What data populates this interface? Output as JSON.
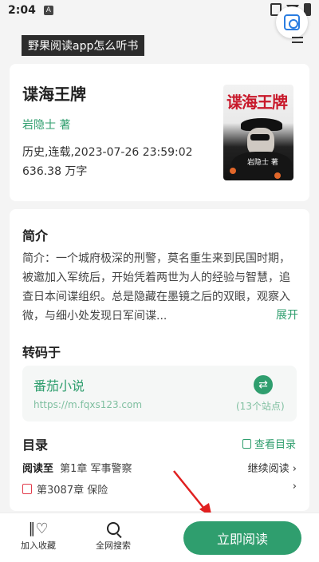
{
  "status_bar": {
    "time": "2:04",
    "a_icon": "A"
  },
  "tooltip": "野果阅读app怎么听书",
  "book": {
    "title": "谍海王牌",
    "author": "岩隐士 著",
    "meta": "历史,连载,2023-07-26 23:59:02",
    "words": "636.38 万字",
    "cover_title": "谍海王牌",
    "cover_author": "岩隐士 著"
  },
  "intro": {
    "heading": "简介",
    "text": "简介：一个城府极深的刑警，莫名重生来到民国时期，被邀加入军统后，开始凭着两世为人的经验与智慧，追查日本间谍组织。总是隐藏在墨镜之后的双眼，观察入微，与细小处发现日军间谍...",
    "expand": "展开"
  },
  "source": {
    "heading": "转码于",
    "name": "番茄小说",
    "url": "https://m.fqxs123.com",
    "count": "(13个站点)"
  },
  "toc": {
    "heading": "目录",
    "link": "查看目录",
    "progress_label": "阅读至",
    "progress_chapter": "第1章 军事警察",
    "continue": "继续阅读",
    "latest": "第3087章 保险"
  },
  "bottom_bar": {
    "collect": "加入收藏",
    "search": "全网搜索",
    "read": "立即阅读"
  },
  "colors": {
    "accent": "#2f9e6e",
    "annotation": "#e02020"
  }
}
